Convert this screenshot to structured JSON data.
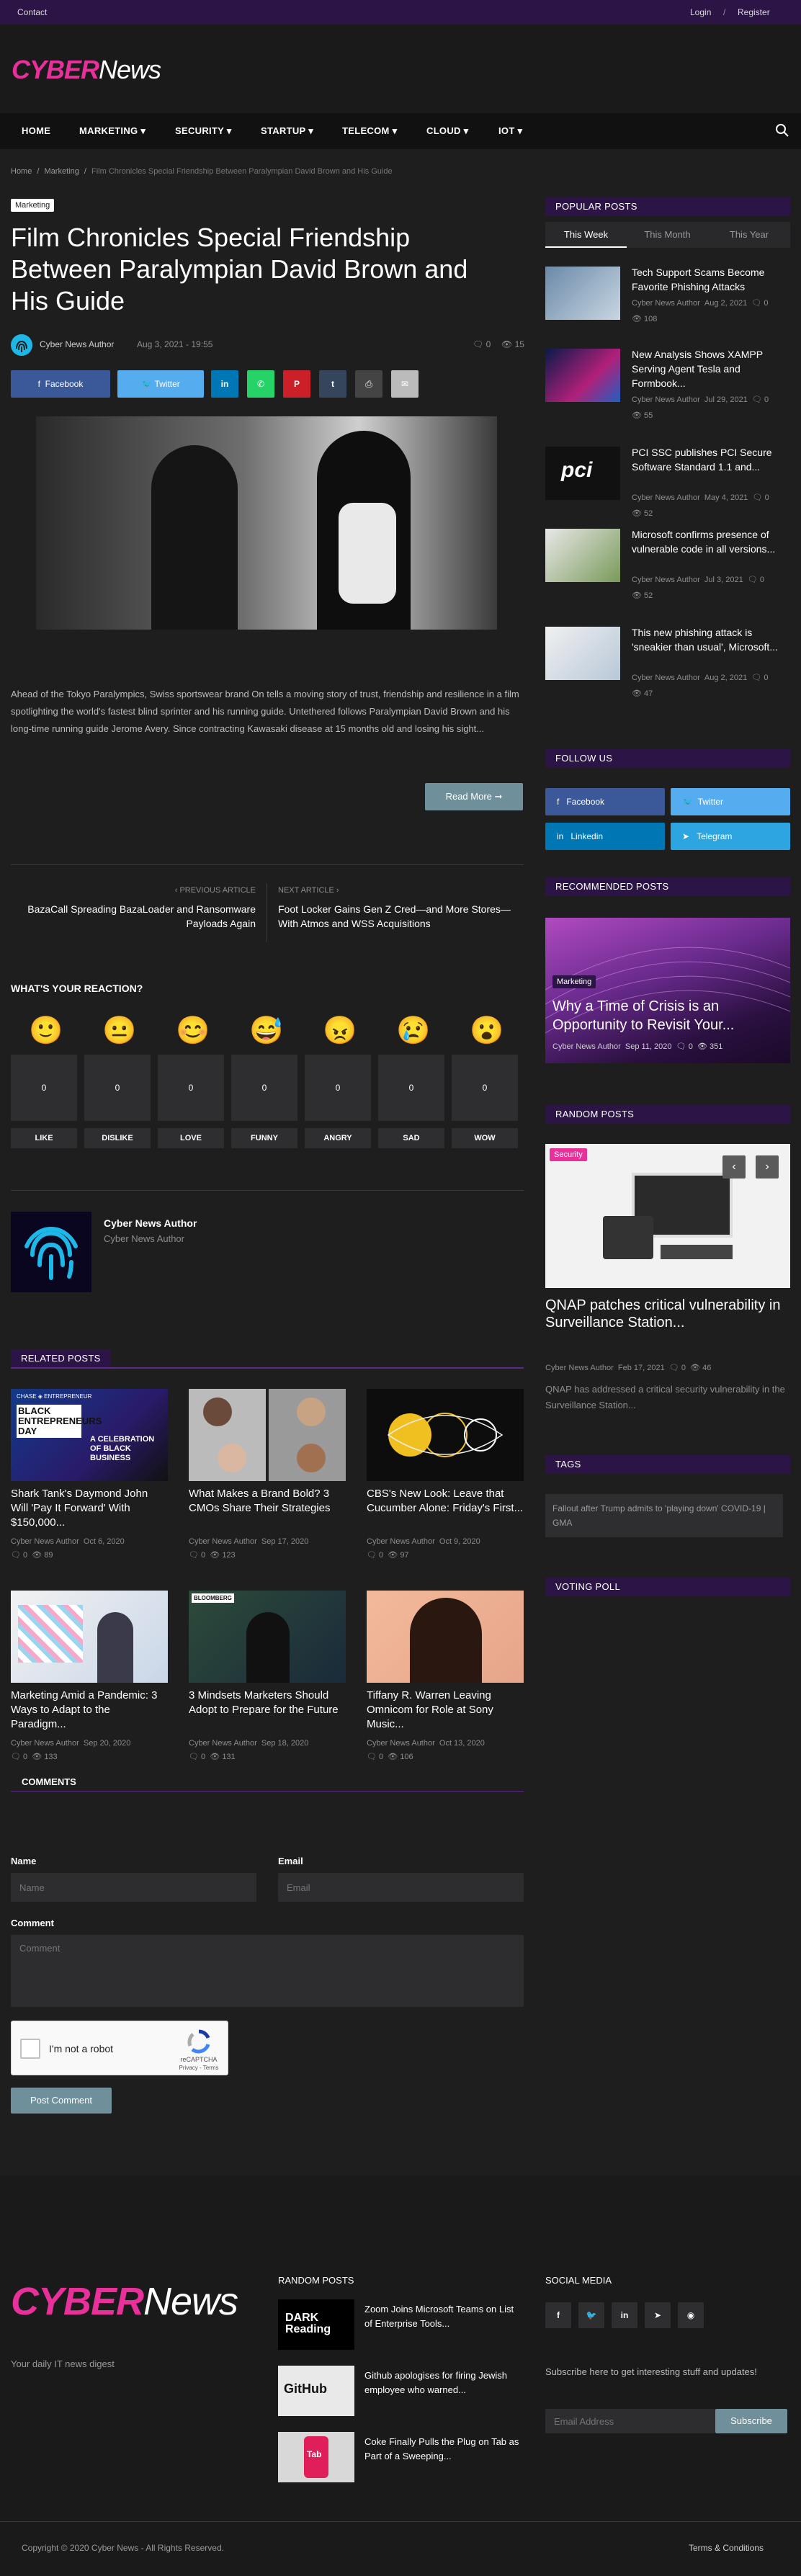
{
  "topbar": {
    "contact": "Contact",
    "login": "Login",
    "sep": "/",
    "register": "Register"
  },
  "brand": {
    "cyber": "CYBER",
    "news": "News",
    "tagline": "Your daily IT news digest"
  },
  "nav": {
    "items": [
      "HOME",
      "MARKETING ▾",
      "SECURITY ▾",
      "STARTUP ▾",
      "TELECOM ▾",
      "CLOUD ▾",
      "IOT ▾"
    ]
  },
  "breadcrumb": {
    "home": "Home",
    "sep1": "/",
    "cat": "Marketing",
    "sep2": "/",
    "current": "Film Chronicles Special Friendship Between Paralympian David Brown and His Guide"
  },
  "article": {
    "tag": "Marketing",
    "title": "Film Chronicles Special Friendship Between Paralympian David Brown and His Guide",
    "author": "Cyber News Author",
    "date": "Aug 3, 2021 - 19:55",
    "comments": "0",
    "views": "15",
    "body": "Ahead of the Tokyo Paralympics, Swiss sportswear brand On tells a moving story of trust, friendship and resilience in a film spotlighting the world's fastest blind sprinter and his running guide. Untethered follows Paralympian David Brown and his long-time running guide Jerome Avery. Since contracting Kawasaki disease at 15 months old and losing his sight...",
    "read_more": "Read More"
  },
  "share": {
    "facebook": "Facebook",
    "twitter": "Twitter",
    "linkedin": "in",
    "whatsapp": "✆",
    "pinterest": "P",
    "tumblr": "t",
    "print": "⎙",
    "email": "✉"
  },
  "prevnext": {
    "prev_label": "‹ PREVIOUS ARTICLE",
    "prev_title": "BazaCall Spreading BazaLoader and Ransomware Payloads Again",
    "next_label": "NEXT ARTICLE ›",
    "next_title": "Foot Locker Gains Gen Z Cred—and More Stores—With Atmos and WSS Acquisitions"
  },
  "reactions": {
    "title": "WHAT'S YOUR REACTION?",
    "items": [
      {
        "label": "LIKE",
        "count": "0"
      },
      {
        "label": "DISLIKE",
        "count": "0"
      },
      {
        "label": "LOVE",
        "count": "0"
      },
      {
        "label": "FUNNY",
        "count": "0"
      },
      {
        "label": "ANGRY",
        "count": "0"
      },
      {
        "label": "SAD",
        "count": "0"
      },
      {
        "label": "WOW",
        "count": "0"
      }
    ]
  },
  "author_box": {
    "name": "Cyber News Author",
    "sub": "Cyber News Author"
  },
  "related": {
    "title": "RELATED POSTS",
    "items": [
      {
        "title": "Shark Tank's Daymond John Will 'Pay It Forward' With $150,000...",
        "author": "Cyber News Author",
        "date": "Oct 6, 2020",
        "comments": "0",
        "views": "89"
      },
      {
        "title": "What Makes a Brand Bold? 3 CMOs Share Their Strategies",
        "author": "Cyber News Author",
        "date": "Sep 17, 2020",
        "comments": "0",
        "views": "123"
      },
      {
        "title": "CBS's New Look: Leave that Cucumber Alone: Friday's First...",
        "author": "Cyber News Author",
        "date": "Oct 9, 2020",
        "comments": "0",
        "views": "97"
      },
      {
        "title": "Marketing Amid a Pandemic: 3 Ways to Adapt to the Paradigm...",
        "author": "Cyber News Author",
        "date": "Sep 20, 2020",
        "comments": "0",
        "views": "133"
      },
      {
        "title": "3 Mindsets Marketers Should Adopt to Prepare for the Future",
        "author": "Cyber News Author",
        "date": "Sep 18, 2020",
        "comments": "0",
        "views": "131"
      },
      {
        "title": "Tiffany R. Warren Leaving Omnicom for Role at Sony Music...",
        "author": "Cyber News Author",
        "date": "Oct 13, 2020",
        "comments": "0",
        "views": "106"
      }
    ]
  },
  "related_img_text": {
    "chase": "CHASE ◈ ENTREPRENEUR",
    "black": "BLACK ENTREPRENEURS DAY",
    "celebration": "A CELEBRATION OF BLACK BUSINESS",
    "bloomberg": "BLOOMBERG"
  },
  "comments": {
    "title": "COMMENTS",
    "name_label": "Name",
    "name_ph": "Name",
    "email_label": "Email",
    "email_ph": "Email",
    "comment_label": "Comment",
    "comment_ph": "Comment",
    "captcha": "I'm not a robot",
    "recaptcha": "reCAPTCHA",
    "privacy": "Privacy - Terms",
    "submit": "Post Comment"
  },
  "sidebar": {
    "popular": {
      "title": "POPULAR POSTS",
      "tabs": [
        "This Week",
        "This Month",
        "This Year"
      ],
      "items": [
        {
          "title": "Tech Support Scams Become Favorite Phishing Attacks",
          "author": "Cyber News Author",
          "date": "Aug 2, 2021",
          "comments": "0",
          "views": "108"
        },
        {
          "title": "New Analysis Shows XAMPP Serving Agent Tesla and Formbook...",
          "author": "Cyber News Author",
          "date": "Jul 29, 2021",
          "comments": "0",
          "views": "55"
        },
        {
          "title": "PCI SSC publishes PCI Secure Software Standard 1.1 and...",
          "author": "Cyber News Author",
          "date": "May 4, 2021",
          "comments": "0",
          "views": "52"
        },
        {
          "title": "Microsoft confirms presence of vulnerable code in all versions...",
          "author": "Cyber News Author",
          "date": "Jul 3, 2021",
          "comments": "0",
          "views": "52"
        },
        {
          "title": "This new phishing attack is 'sneakier than usual', Microsoft...",
          "author": "Cyber News Author",
          "date": "Aug 2, 2021",
          "comments": "0",
          "views": "47"
        }
      ],
      "pci": "pci"
    },
    "follow": {
      "title": "FOLLOW US",
      "facebook": "Facebook",
      "twitter": "Twitter",
      "linkedin": "Linkedin",
      "telegram": "Telegram"
    },
    "recommended": {
      "title": "RECOMMENDED POSTS",
      "tag": "Marketing",
      "post_title": "Why a Time of Crisis is an Opportunity to Revisit Your...",
      "author": "Cyber News Author",
      "date": "Sep 11, 2020",
      "comments": "0",
      "views": "351"
    },
    "random": {
      "title": "RANDOM POSTS",
      "tag": "Security",
      "post_title": "QNAP patches critical vulnerability in Surveillance Station...",
      "author": "Cyber News Author",
      "date": "Feb 17, 2021",
      "comments": "0",
      "views": "46",
      "excerpt": "QNAP has addressed a critical security vulnerability in the Surveillance Station..."
    },
    "tags": {
      "title": "TAGS",
      "tag1": "Fallout after Trump admits to 'playing down' COVID-19 | GMA"
    },
    "poll": {
      "title": "VOTING POLL"
    }
  },
  "footer": {
    "random_title": "RANDOM POSTS",
    "random": [
      {
        "title": "Zoom Joins Microsoft Teams on List of Enterprise Tools..."
      },
      {
        "title": "Github apologises for firing Jewish employee who warned..."
      },
      {
        "title": "Coke Finally Pulls the Plug on Tab as Part of a Sweeping..."
      }
    ],
    "dark_reading": "DARK Reading",
    "github": "GitHub",
    "tab": "Tab",
    "social_title": "SOCIAL MEDIA",
    "subscribe_text": "Subscribe here to get interesting stuff and updates!",
    "email_ph": "Email Address",
    "subscribe_btn": "Subscribe",
    "copyright": "Copyright © 2020 Cyber News - All Rights Reserved.",
    "terms": "Terms & Conditions"
  },
  "colors": {
    "accent": "#2c1447",
    "pink": "#e8309a",
    "facebook": "#3b5998",
    "twitter": "#55acee",
    "teal": "#1db8e8"
  }
}
